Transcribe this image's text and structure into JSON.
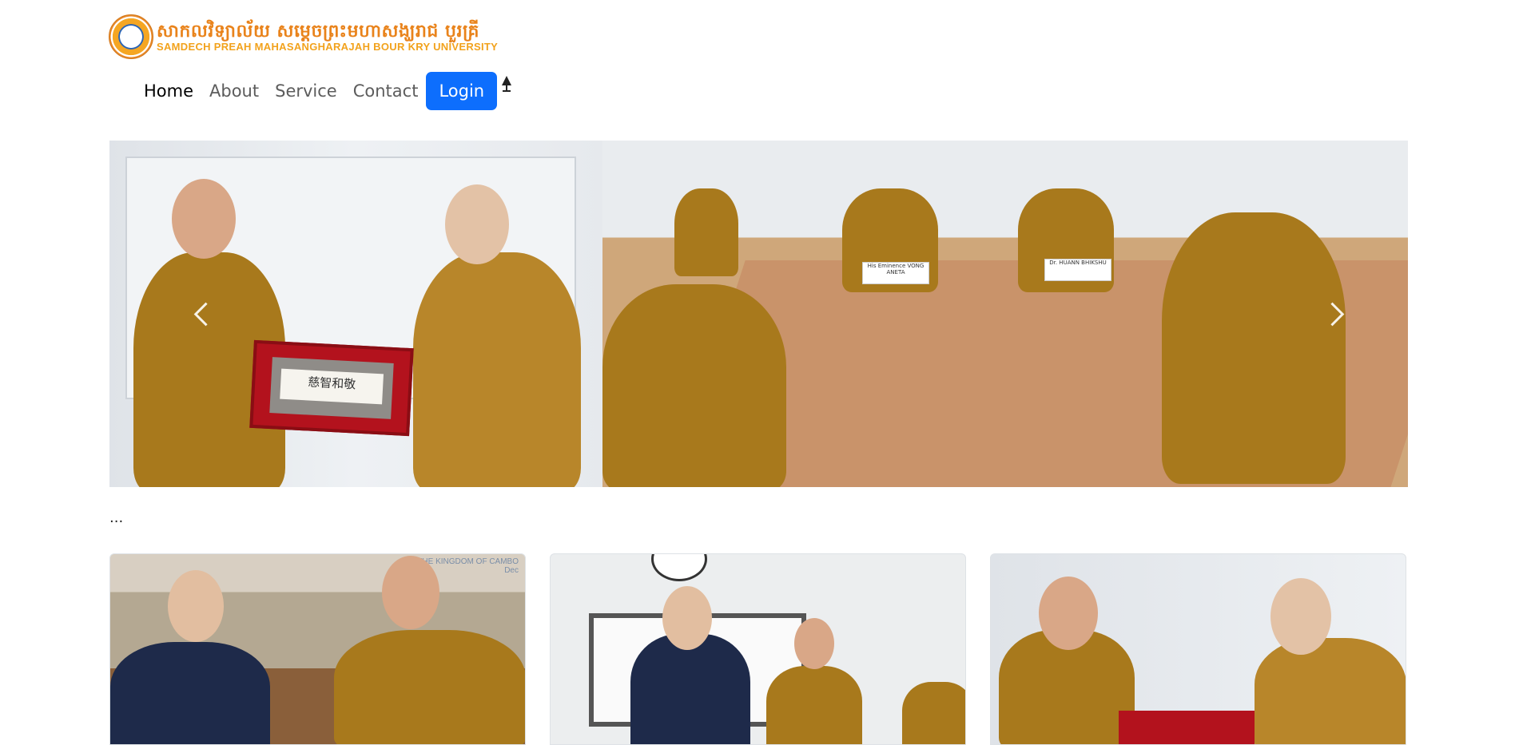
{
  "logo": {
    "khmer_text": "សាកលវិទ្យាល័យ សម្ដេចព្រះមហាសង្ឃរាជ បួរគ្រី",
    "english_text": "SAMDECH PREAH MAHASANGHARAJAH BOUR KRY UNIVERSITY"
  },
  "nav": {
    "items": [
      "Home",
      "About",
      "Service",
      "Contact"
    ],
    "active": "Home",
    "login_label": "Login"
  },
  "carousel": {
    "plaque_text": "慈智和敬",
    "nameplate_left": "His Eminence VONG ANETA",
    "nameplate_right": "Dr. HUANN BHIKSHU"
  },
  "section": {
    "ellipsis": "..."
  },
  "cards": {
    "card1_banner": "THE KINGDOM OF CAMBO\nDec"
  },
  "colors": {
    "primary": "#0d6efd",
    "logo_orange": "#e9831b",
    "robe": "#a8791c"
  }
}
